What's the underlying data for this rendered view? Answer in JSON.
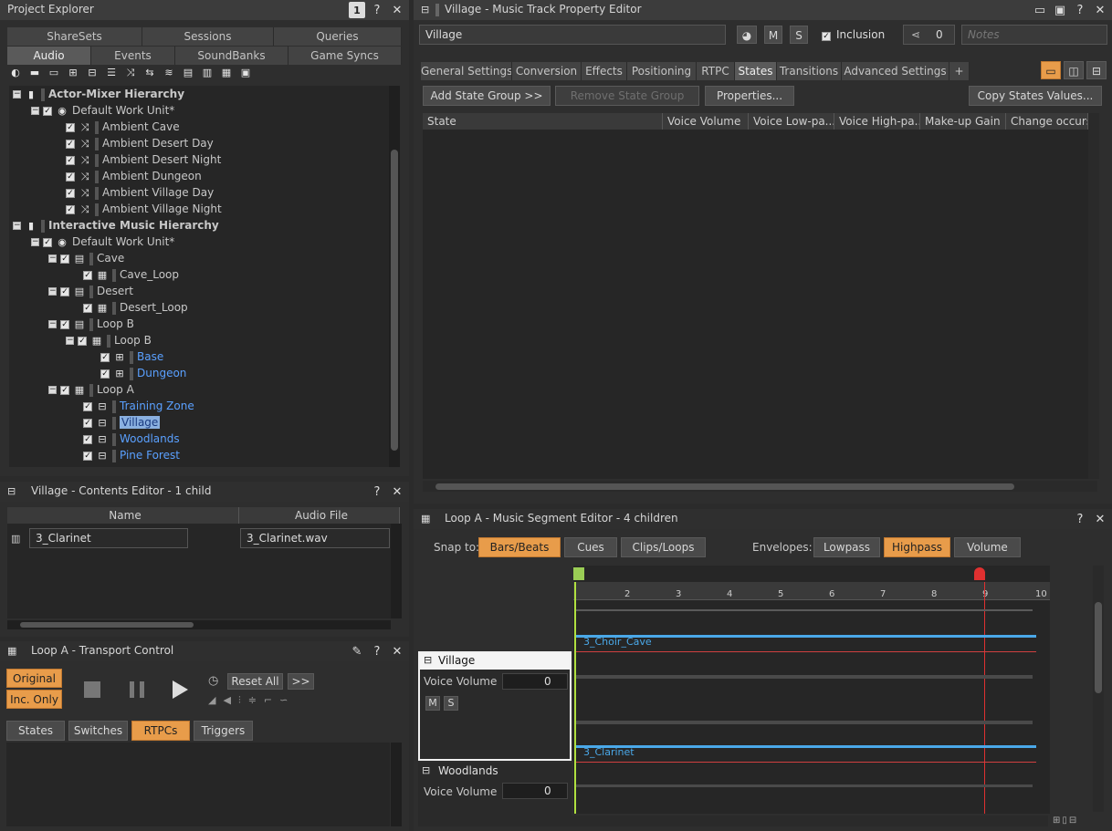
{
  "project_explorer": {
    "title": "Project Explorer",
    "window_badge": "1",
    "top_tabs": [
      "ShareSets",
      "Sessions",
      "Queries"
    ],
    "main_tabs": [
      "Audio",
      "Events",
      "SoundBanks",
      "Game Syncs"
    ],
    "tree": [
      {
        "label": "Actor-Mixer Hierarchy",
        "bold": true
      },
      {
        "label": "Default Work Unit*"
      },
      {
        "label": "Ambient Cave"
      },
      {
        "label": "Ambient Desert Day"
      },
      {
        "label": "Ambient Desert Night"
      },
      {
        "label": "Ambient Dungeon"
      },
      {
        "label": "Ambient Village Day"
      },
      {
        "label": "Ambient Village Night"
      },
      {
        "label": "Interactive Music Hierarchy",
        "bold": true
      },
      {
        "label": "Default Work Unit*"
      },
      {
        "label": "Cave"
      },
      {
        "label": "Cave_Loop"
      },
      {
        "label": "Desert"
      },
      {
        "label": "Desert_Loop"
      },
      {
        "label": "Loop B"
      },
      {
        "label": "Loop B"
      },
      {
        "label": "Base"
      },
      {
        "label": "Dungeon"
      },
      {
        "label": "Loop A"
      },
      {
        "label": "Training Zone"
      },
      {
        "label": "Village"
      },
      {
        "label": "Woodlands"
      },
      {
        "label": "Pine Forest"
      }
    ]
  },
  "contents_editor": {
    "title": "Village - Contents Editor - 1 child",
    "col_name": "Name",
    "col_file": "Audio File",
    "row_name": "3_Clarinet",
    "row_file": "3_Clarinet.wav"
  },
  "transport": {
    "title": "Loop A - Transport Control",
    "original": "Original",
    "inc_only": "Inc. Only",
    "reset_all": "Reset All",
    "more": ">>",
    "tabs": [
      "States",
      "Switches",
      "RTPCs",
      "Triggers"
    ]
  },
  "property_editor": {
    "title": "Village - Music Track Property Editor",
    "name_value": "Village",
    "m": "M",
    "s": "S",
    "inclusion": "Inclusion",
    "ref_count": "0",
    "notes_placeholder": "Notes",
    "tabs": [
      "General Settings",
      "Conversion",
      "Effects",
      "Positioning",
      "RTPC",
      "States",
      "Transitions",
      "Advanced Settings",
      "+"
    ],
    "add_state_group": "Add State Group >>",
    "remove_state_group": "Remove State Group",
    "properties": "Properties...",
    "copy_states": "Copy States Values...",
    "columns": [
      "State",
      "Voice Volume",
      "Voice Low-pa...",
      "Voice High-pa...",
      "Make-up Gain",
      "Change occurs a"
    ]
  },
  "segment_editor": {
    "title": "Loop A - Music Segment Editor - 4 children",
    "snap_to": "Snap to:",
    "snap_options": [
      "Bars/Beats",
      "Cues",
      "Clips/Loops"
    ],
    "envelopes": "Envelopes:",
    "envelope_options": [
      "Lowpass",
      "Highpass",
      "Volume"
    ],
    "ruler": [
      "2",
      "3",
      "4",
      "5",
      "6",
      "7",
      "8",
      "9",
      "10"
    ],
    "tracks": [
      {
        "name": "Village",
        "param": "Voice Volume",
        "value": "0",
        "clip": "3_Choir_Cave"
      },
      {
        "name": "Woodlands",
        "param": "Voice Volume",
        "value": "0",
        "clip": "3_Clarinet"
      }
    ]
  }
}
